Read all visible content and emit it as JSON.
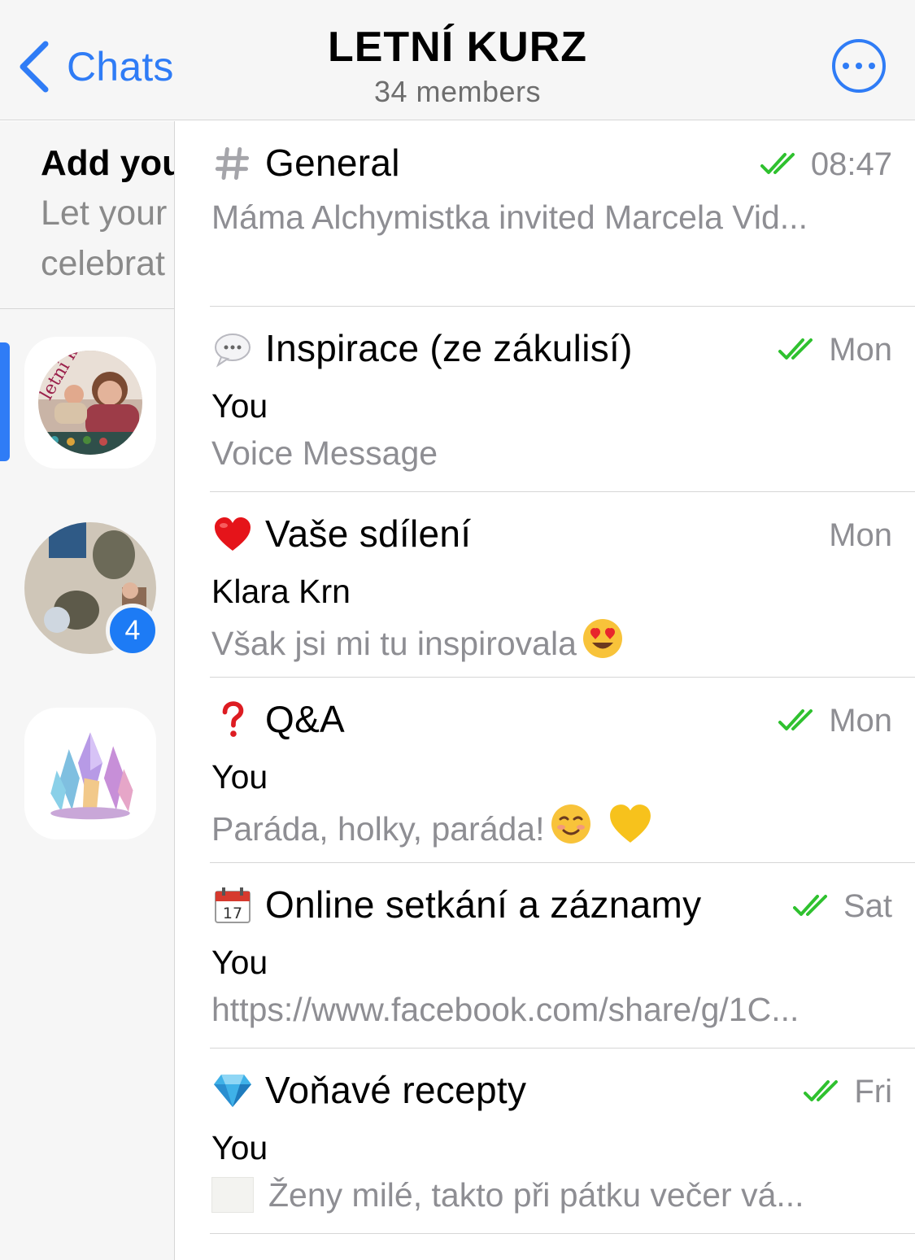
{
  "header": {
    "back_label": "Chats",
    "title": "LETNÍ KURZ",
    "subtitle": "34 members"
  },
  "sidebar": {
    "promo_title": "Add your",
    "promo_line1": "Let your",
    "promo_line2": "celebrat",
    "groups": [
      {
        "avatar": "letni-kurz-group-photo",
        "active": true
      },
      {
        "avatar": "stones-group-photo",
        "unread": "4"
      },
      {
        "avatar": "crystals-group-photo"
      }
    ]
  },
  "channels": [
    {
      "icon": "hash-icon",
      "name": "General",
      "time": "08:47",
      "read": true,
      "sender": "",
      "preview": "Máma Alchymistka invited Marcela Vid..."
    },
    {
      "icon": "speech-bubble-icon",
      "name": "Inspirace (ze zákulisí)",
      "time": "Mon",
      "read": true,
      "sender": "You",
      "preview": "Voice Message"
    },
    {
      "icon": "red-heart-icon",
      "name": "Vaše sdílení",
      "time": "Mon",
      "read": false,
      "sender": "Klara Krn",
      "preview": "Však jsi mi tu inspirovala"
    },
    {
      "icon": "question-mark-icon",
      "name": "Q&A",
      "time": "Mon",
      "read": true,
      "sender": "You",
      "preview": "Paráda, holky, paráda! "
    },
    {
      "icon": "calendar-icon",
      "name": "Online setkání a záznamy",
      "time": "Sat",
      "read": true,
      "sender": "You",
      "preview": "https://www.facebook.com/share/g/1C..."
    },
    {
      "icon": "gem-icon",
      "name": "Voňavé recepty",
      "time": "Fri",
      "read": true,
      "sender": "You",
      "preview": "Ženy milé, takto při pátku večer vá..."
    }
  ],
  "colors": {
    "accent": "#2f7cf6",
    "read_tick": "#2fc12f",
    "secondary_text": "#8e8e93"
  }
}
